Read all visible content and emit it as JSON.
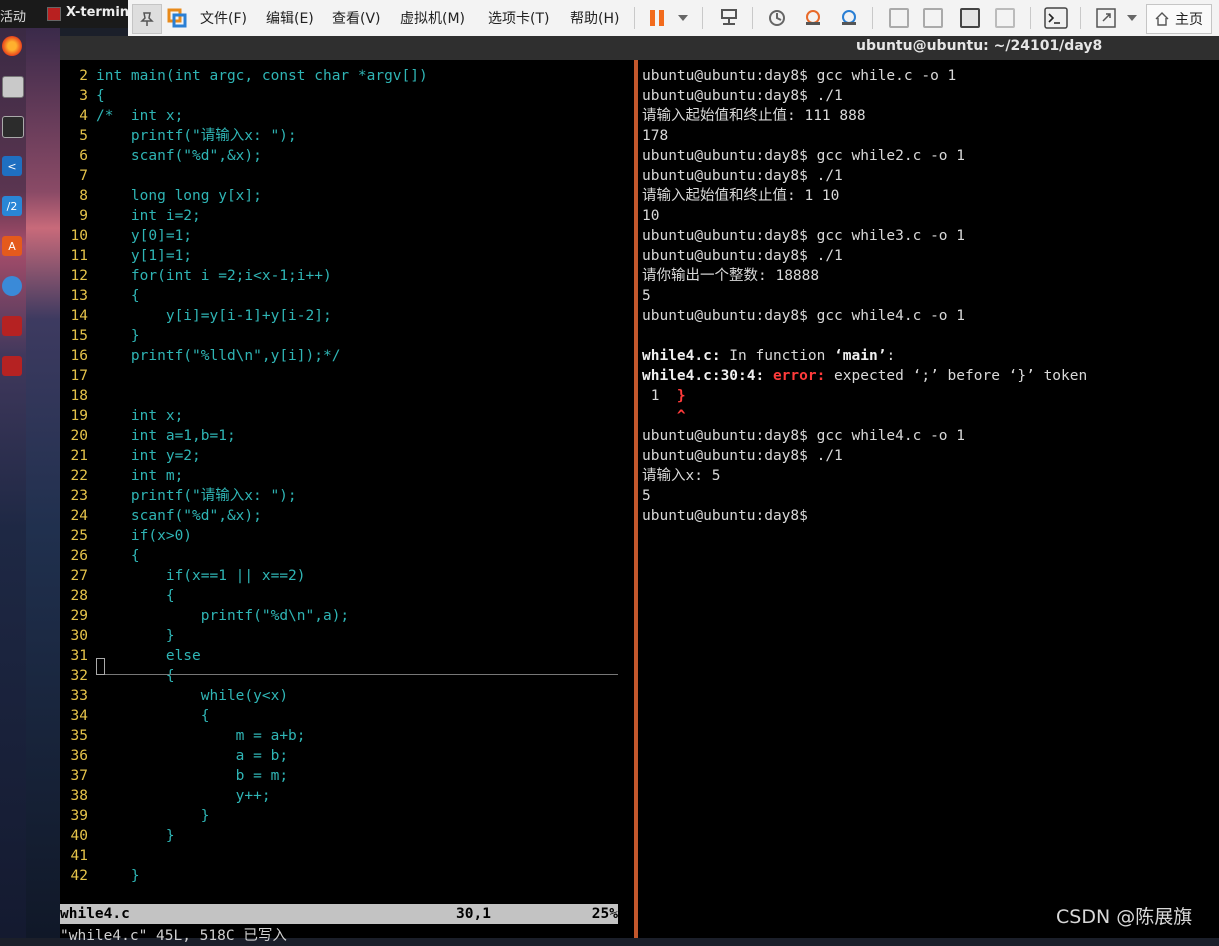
{
  "gnome": {
    "activities": "活动",
    "app_name": "X-termin"
  },
  "toolbar": {
    "menus": [
      "文件(F)",
      "编辑(E)",
      "查看(V)",
      "虚拟机(M)",
      "选项卡(T)",
      "帮助(H)"
    ],
    "home_label": "主页"
  },
  "window": {
    "title": "ubuntu@ubuntu: ~/24101/day8"
  },
  "vim": {
    "lines": [
      {
        "n": "2",
        "t": "int main(int argc, const char *argv[])"
      },
      {
        "n": "3",
        "t": "{"
      },
      {
        "n": "4",
        "t": "/*  int x;"
      },
      {
        "n": "5",
        "t": "    printf(\"请输入x: \");"
      },
      {
        "n": "6",
        "t": "    scanf(\"%d\",&x);"
      },
      {
        "n": "7",
        "t": ""
      },
      {
        "n": "8",
        "t": "    long long y[x];"
      },
      {
        "n": "9",
        "t": "    int i=2;"
      },
      {
        "n": "10",
        "t": "    y[0]=1;"
      },
      {
        "n": "11",
        "t": "    y[1]=1;"
      },
      {
        "n": "12",
        "t": "    for(int i =2;i<x-1;i++)"
      },
      {
        "n": "13",
        "t": "    {"
      },
      {
        "n": "14",
        "t": "        y[i]=y[i-1]+y[i-2];"
      },
      {
        "n": "15",
        "t": "    }"
      },
      {
        "n": "16",
        "t": "    printf(\"%lld\\n\",y[i]);*/"
      },
      {
        "n": "17",
        "t": ""
      },
      {
        "n": "18",
        "t": ""
      },
      {
        "n": "19",
        "t": "    int x;"
      },
      {
        "n": "20",
        "t": "    int a=1,b=1;"
      },
      {
        "n": "21",
        "t": "    int y=2;"
      },
      {
        "n": "22",
        "t": "    int m;"
      },
      {
        "n": "23",
        "t": "    printf(\"请输入x: \");"
      },
      {
        "n": "24",
        "t": "    scanf(\"%d\",&x);"
      },
      {
        "n": "25",
        "t": "    if(x>0)"
      },
      {
        "n": "26",
        "t": "    {"
      },
      {
        "n": "27",
        "t": "        if(x==1 || x==2)"
      },
      {
        "n": "28",
        "t": "        {"
      },
      {
        "n": "29",
        "t": "            printf(\"%d\\n\",a);"
      },
      {
        "n": "30",
        "t": "        }"
      },
      {
        "n": "31",
        "t": "        else"
      },
      {
        "n": "32",
        "t": "        {"
      },
      {
        "n": "33",
        "t": "            while(y<x)"
      },
      {
        "n": "34",
        "t": "            {"
      },
      {
        "n": "35",
        "t": "                m = a+b;"
      },
      {
        "n": "36",
        "t": "                a = b;"
      },
      {
        "n": "37",
        "t": "                b = m;"
      },
      {
        "n": "38",
        "t": "                y++;"
      },
      {
        "n": "39",
        "t": "            }"
      },
      {
        "n": "40",
        "t": "        }"
      },
      {
        "n": "41",
        "t": ""
      },
      {
        "n": "42",
        "t": "    }"
      }
    ],
    "status": {
      "filename": "while4.c",
      "position": "30,1",
      "percent": "25%"
    },
    "message": "\"while4.c\" 45L, 518C 已写入"
  },
  "shell": {
    "lines": [
      "ubuntu@ubuntu:day8$ gcc while.c -o 1",
      "ubuntu@ubuntu:day8$ ./1",
      "请输入起始值和终止值: 111 888",
      "178",
      "ubuntu@ubuntu:day8$ gcc while2.c -o 1",
      "ubuntu@ubuntu:day8$ ./1",
      "请输入起始值和终止值: 1 10",
      "10",
      "ubuntu@ubuntu:day8$ gcc while3.c -o 1",
      "ubuntu@ubuntu:day8$ ./1",
      "请你输出一个整数: 18888",
      "5",
      "ubuntu@ubuntu:day8$ gcc while4.c -o 1"
    ],
    "error_in_function": {
      "file": "while4.c:",
      "text": " In function ",
      "name": "‘main’",
      "colon": ":"
    },
    "error_line": {
      "loc": "while4.c:30:4:",
      "label": " error:",
      "text": " expected ‘;’ before ‘}’ token"
    },
    "error_src": {
      "num": " 1  ",
      "char": "}"
    },
    "error_caret": "^",
    "after": [
      "ubuntu@ubuntu:day8$ gcc while4.c -o 1",
      "ubuntu@ubuntu:day8$ ./1",
      "请输入x: 5",
      "5",
      "ubuntu@ubuntu:day8$"
    ]
  },
  "watermark": "CSDN @陈展旗"
}
